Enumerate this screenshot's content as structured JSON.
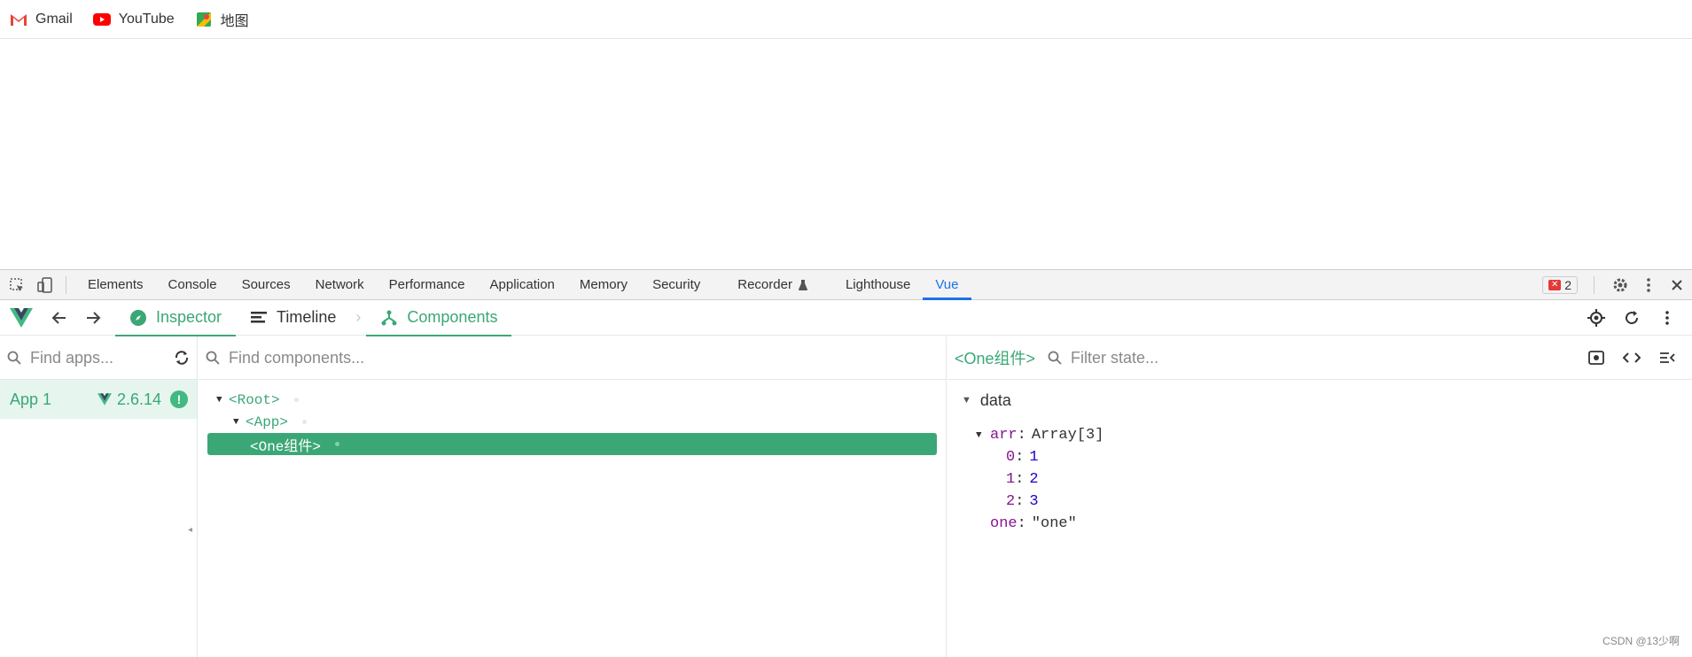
{
  "bookmarks": [
    {
      "label": "Gmail",
      "icon": "gmail-icon"
    },
    {
      "label": "YouTube",
      "icon": "youtube-icon"
    },
    {
      "label": "地图",
      "icon": "maps-icon"
    }
  ],
  "devtools": {
    "tabs": [
      "Elements",
      "Console",
      "Sources",
      "Network",
      "Performance",
      "Application",
      "Memory",
      "Security",
      "Recorder",
      "Lighthouse",
      "Vue"
    ],
    "active_tab": "Vue",
    "error_count": "2"
  },
  "vue": {
    "tabs": {
      "inspector": "Inspector",
      "timeline": "Timeline",
      "components": "Components"
    },
    "active_tab": "Components",
    "apps_search_placeholder": "Find apps...",
    "components_search_placeholder": "Find components...",
    "state_search_placeholder": "Filter state...",
    "app": {
      "name": "App 1",
      "version": "2.6.14"
    },
    "tree": [
      {
        "label": "<Root>",
        "depth": 0,
        "expanded": true
      },
      {
        "label": "<App>",
        "depth": 1,
        "expanded": true
      },
      {
        "label": "<One组件>",
        "depth": 2,
        "selected": true
      }
    ],
    "selected_component": "<One组件>",
    "state": {
      "section": "data",
      "arr_key": "arr",
      "arr_type": "Array[3]",
      "arr_items": [
        {
          "index": "0",
          "value": "1"
        },
        {
          "index": "1",
          "value": "2"
        },
        {
          "index": "2",
          "value": "3"
        }
      ],
      "one_key": "one",
      "one_value": "\"one\""
    }
  },
  "colors": {
    "vue_green": "#3ba776",
    "devtools_blue": "#1a73e8"
  },
  "watermark": "CSDN @13少啊"
}
